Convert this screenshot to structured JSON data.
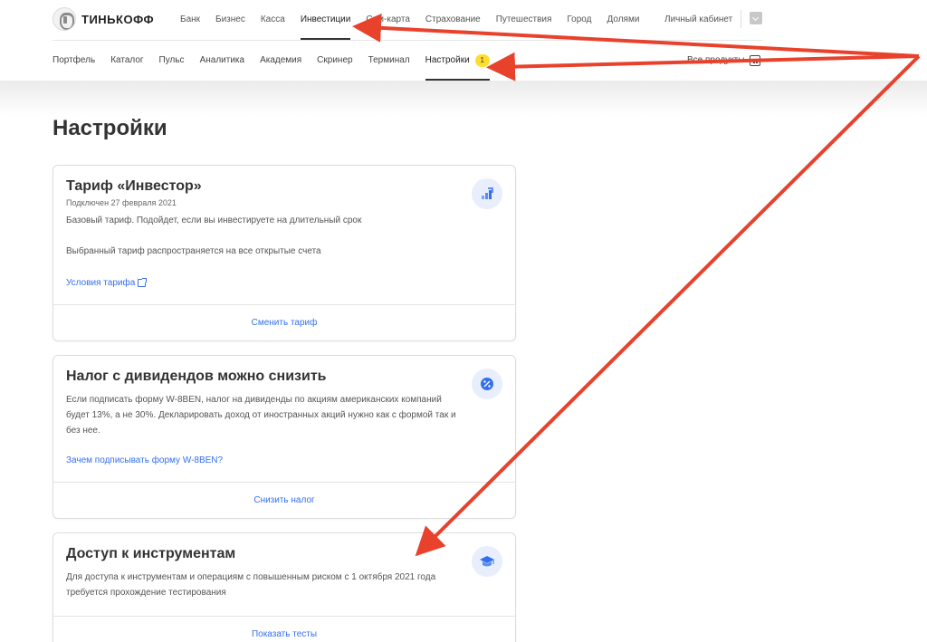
{
  "header": {
    "logo_text": "ТИНЬКОФФ",
    "nav": [
      {
        "label": "Банк",
        "active": false
      },
      {
        "label": "Бизнес",
        "active": false
      },
      {
        "label": "Касса",
        "active": false
      },
      {
        "label": "Инвестиции",
        "active": true
      },
      {
        "label": "Сим-карта",
        "active": false
      },
      {
        "label": "Страхование",
        "active": false
      },
      {
        "label": "Путешествия",
        "active": false
      },
      {
        "label": "Город",
        "active": false
      },
      {
        "label": "Долями",
        "active": false
      }
    ],
    "account_label": "Личный кабинет"
  },
  "subnav": {
    "items": [
      {
        "label": "Портфель"
      },
      {
        "label": "Каталог"
      },
      {
        "label": "Пульс"
      },
      {
        "label": "Аналитика"
      },
      {
        "label": "Академия"
      },
      {
        "label": "Скринер"
      },
      {
        "label": "Терминал"
      },
      {
        "label": "Настройки",
        "badge": "1"
      }
    ],
    "all_products": "Все продукты"
  },
  "page": {
    "title": "Настройки"
  },
  "cards": {
    "tariff": {
      "title": "Тариф «Инвестор»",
      "subtitle": "Подключен 27 февраля 2021",
      "text1": "Базовый тариф. Подойдет, если вы инвестируете на длительный срок",
      "text2": "Выбранный тариф распространяется на все открытые счета",
      "link": "Условия тарифа",
      "action": "Сменить тариф",
      "icon": "chart-up-icon"
    },
    "tax": {
      "title": "Налог с дивидендов можно снизить",
      "text": "Если подписать форму W-8BEN, налог на дивиденды по акциям американских компаний будет 13%, а не 30%. Декларировать доход от иностранных акций нужно как с формой так и без нее.",
      "link": "Зачем подписывать форму W-8BEN?",
      "action": "Снизить налог",
      "icon": "percent-icon"
    },
    "access": {
      "title": "Доступ к инструментам",
      "text": "Для доступа к инструментам и операциям с повышенным риском с 1 октября 2021 года требуется прохождение тестирования",
      "action": "Показать тесты",
      "icon": "graduation-cap-icon"
    }
  },
  "colors": {
    "accent": "#336fee",
    "badge": "#ffdd2d",
    "annotation_arrow": "#e8412c"
  }
}
